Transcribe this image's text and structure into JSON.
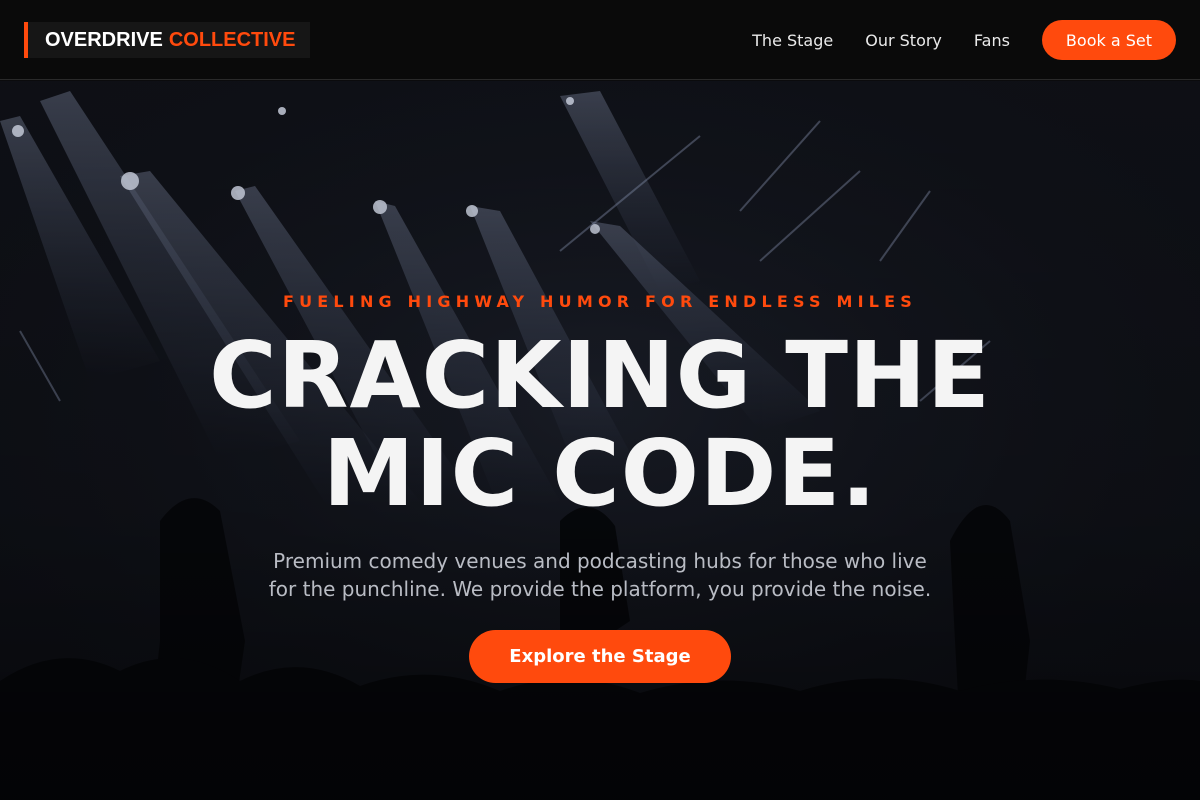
{
  "brand": {
    "name_part1": "OVERDRIVE",
    "name_part2": "COLLECTIVE"
  },
  "nav": {
    "links": [
      {
        "label": "The Stage"
      },
      {
        "label": "Our Story"
      },
      {
        "label": "Fans"
      }
    ],
    "cta_label": "Book a Set"
  },
  "hero": {
    "eyebrow": "FUELING HIGHWAY HUMOR FOR ENDLESS MILES",
    "headline_line1": "CRACKING THE",
    "headline_line2": "MIC CODE.",
    "description_line1": "Premium comedy venues and podcasting hubs for those who live",
    "description_line2": "for the punchline. We provide the platform, you provide the noise.",
    "cta_label": "Explore the Stage",
    "background_image": "concert-stage-photo"
  },
  "colors": {
    "accent": "#ff4a0d",
    "header_bg": "#0a0a0a",
    "headline": "#f4f4f4",
    "body_text": "#b9bcc4"
  }
}
